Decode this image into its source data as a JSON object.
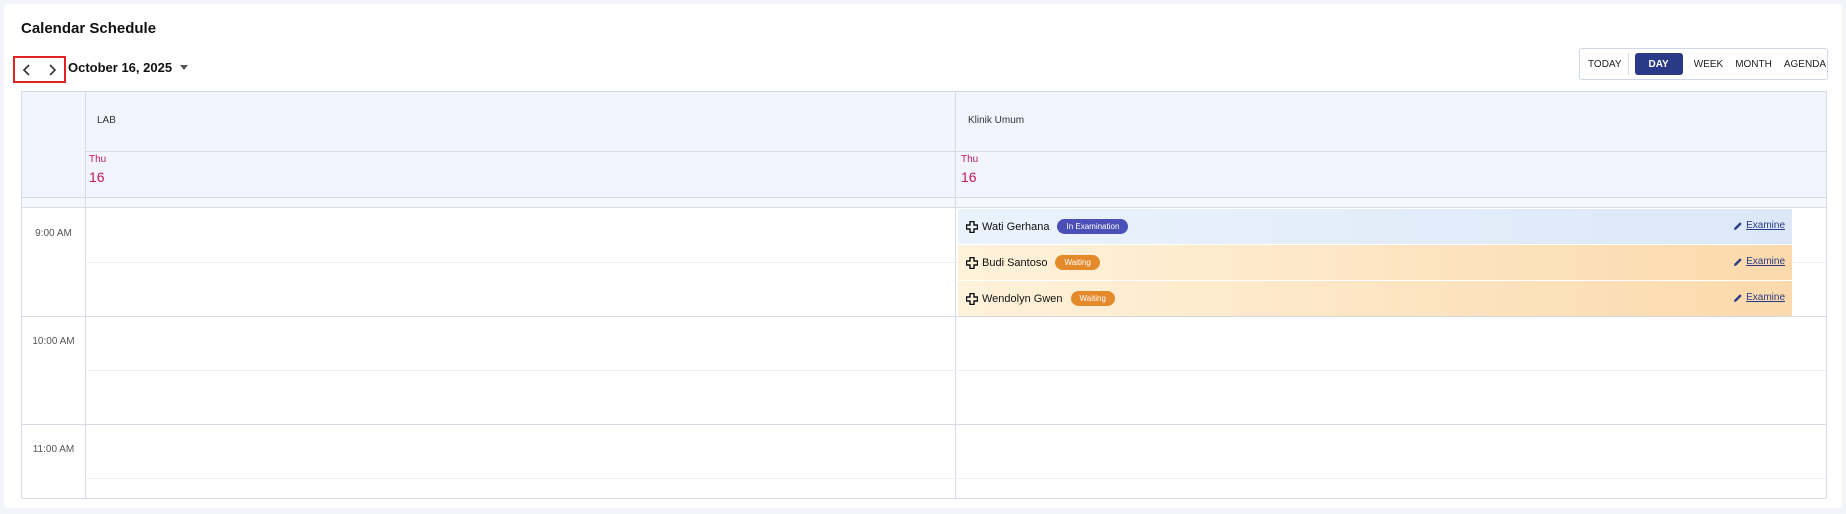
{
  "page": {
    "title": "Calendar Schedule"
  },
  "toolbar": {
    "date_label": "October 16, 2025",
    "views": {
      "today": "TODAY",
      "day": "DAY",
      "week": "WEEK",
      "month": "MONTH",
      "agenda": "AGENDA"
    },
    "active_view": "DAY"
  },
  "resources": [
    {
      "name": "LAB",
      "day_name": "Thu",
      "day_num": "16"
    },
    {
      "name": "Klinik Umum",
      "day_name": "Thu",
      "day_num": "16"
    }
  ],
  "time_slots": [
    "9:00 AM",
    "10:00 AM",
    "11:00 AM"
  ],
  "events": [
    {
      "patient": "Wati Gerhana",
      "status": "In Examination",
      "action": "Examine"
    },
    {
      "patient": "Budi Santoso",
      "status": "Waiting",
      "action": "Examine"
    },
    {
      "patient": "Wendolyn Gwen",
      "status": "Waiting",
      "action": "Examine"
    }
  ],
  "icons": {
    "prev": "chevron-left-icon",
    "next": "chevron-right-icon",
    "patient": "medical-cross-icon",
    "edit": "pencil-icon"
  },
  "colors": {
    "accent": "#2b3a87",
    "day_highlight": "#c2185b",
    "status_examination": "#4a50b8",
    "status_waiting": "#e48a2b"
  }
}
